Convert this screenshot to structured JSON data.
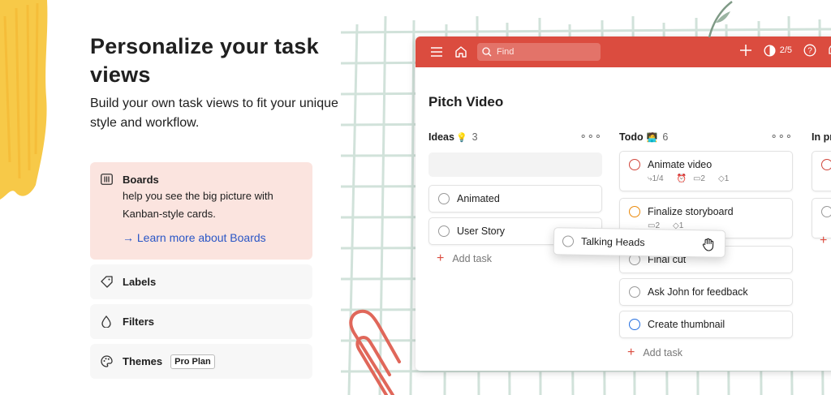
{
  "hero": {
    "title": "Personalize your task views",
    "subtitle": "Build your own task views to fit your unique style and workflow."
  },
  "features": [
    {
      "label": "Boards",
      "icon": "board-icon",
      "desc": "help you see the big picture with Kanban-style cards.",
      "link": "→ Learn more about Boards",
      "active": true
    },
    {
      "label": "Labels",
      "icon": "tag-icon"
    },
    {
      "label": "Filters",
      "icon": "drop-icon"
    },
    {
      "label": "Themes",
      "icon": "palette-icon",
      "badge": "Pro Plan"
    }
  ],
  "app": {
    "search_placeholder": "Find",
    "karma": "2/5",
    "project_title": "Pitch Video",
    "columns": [
      {
        "title": "Ideas",
        "emoji": "💡",
        "count": "3",
        "tasks": [
          {
            "name": "Animated"
          },
          {
            "name": "User Story"
          }
        ],
        "add_label": "Add task"
      },
      {
        "title": "Todo",
        "emoji": "🧑‍💻",
        "count": "6",
        "tasks": [
          {
            "name": "Animate video",
            "priority": "red",
            "meta": [
              "1/4",
              "⏰",
              "2",
              "1"
            ]
          },
          {
            "name": "Finalize storyboard",
            "priority": "orange",
            "meta": [
              "2",
              "1"
            ]
          },
          {
            "name": "Final cut"
          },
          {
            "name": "Ask John for feedback"
          },
          {
            "name": "Create thumbnail",
            "priority": "blue"
          }
        ],
        "add_label": "Add task"
      },
      {
        "title": "In pr",
        "emoji": "",
        "count": ""
      }
    ],
    "dragging_task": "Talking Heads"
  },
  "colors": {
    "brand_red": "#db4c3f",
    "active_feature_bg": "#fbe4df",
    "link_blue": "#2a56c6",
    "priority_red": "#d1453b",
    "priority_orange": "#eb8909",
    "priority_blue": "#246fe0"
  }
}
